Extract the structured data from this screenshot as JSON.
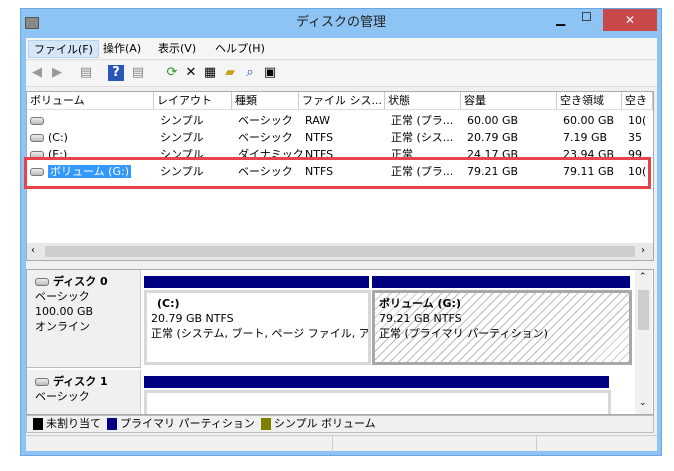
{
  "window": {
    "title": "ディスクの管理",
    "close": "✕",
    "minimize": "▁",
    "maximize": "☐"
  },
  "menu": [
    "ファイル(F)",
    "操作(A)",
    "表示(V)",
    "ヘルプ(H)"
  ],
  "toolbar": [
    "back-icon",
    "forward-icon",
    "console-tree-icon",
    "help-icon",
    "action-pane-icon",
    "refresh-icon",
    "delete-icon",
    "properties-icon",
    "open-icon",
    "explore-icon",
    "settings-icon"
  ],
  "list": {
    "columns": [
      "ボリューム",
      "レイアウト",
      "種類",
      "ファイル シス...",
      "状態",
      "容量",
      "空き領域",
      "空き"
    ],
    "rows": [
      [
        "",
        "シンプル",
        "ベーシック",
        "RAW",
        "正常 (プラ...",
        "60.00 GB",
        "60.00 GB",
        "10("
      ],
      [
        "(C:)",
        "シンプル",
        "ベーシック",
        "NTFS",
        "正常 (シス...",
        "20.79 GB",
        "7.19 GB",
        "35"
      ],
      [
        "(E:)",
        "シンプル",
        "ダイナミック",
        "NTFS",
        "正常",
        "24.17 GB",
        "23.94 GB",
        "99"
      ],
      [
        "ボリューム (G:)",
        "シンプル",
        "ベーシック",
        "NTFS",
        "正常 (プラ...",
        "79.21 GB",
        "79.11 GB",
        "10("
      ]
    ],
    "selected_row": 3
  },
  "disks": [
    {
      "name": "ディスク 0",
      "type": "ベーシック",
      "size": "100.00 GB",
      "status": "オンライン",
      "partitions": [
        {
          "name": "(C:)",
          "size": "20.79 GB NTFS",
          "status": "正常 (システム, ブート, ページ ファイル, アクラ"
        },
        {
          "name": "ボリューム (G:)",
          "size": "79.21 GB NTFS",
          "status": "正常 (プライマリ パーティション)"
        }
      ]
    },
    {
      "name": "ディスク 1",
      "type": "ベーシック"
    }
  ],
  "legend": [
    {
      "label": "未割り当て",
      "color": "#000000"
    },
    {
      "label": "プライマリ パーティション",
      "color": "#000080"
    },
    {
      "label": "シンプル ボリューム",
      "color": "#808000"
    }
  ],
  "colors": {
    "titlebar": "#8ec4f4",
    "close": "#c9484a",
    "highlight": "#e8434a",
    "selection": "#3399ff"
  }
}
